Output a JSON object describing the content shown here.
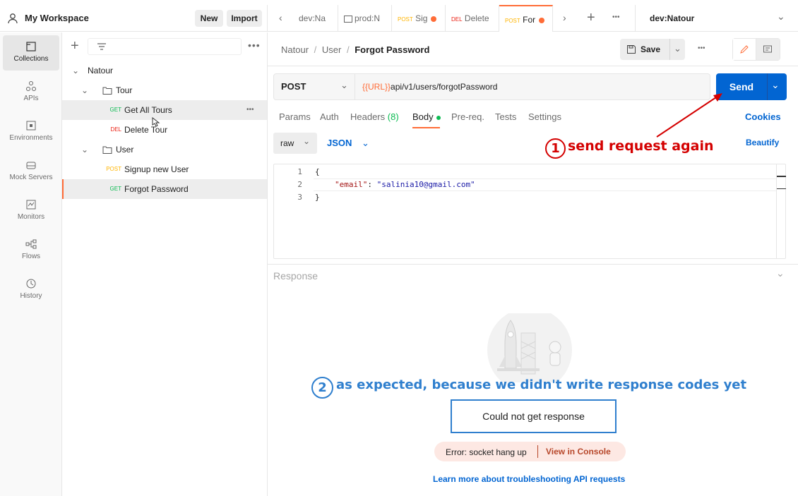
{
  "workspace": {
    "title": "My Workspace",
    "new_label": "New",
    "import_label": "Import"
  },
  "rail": [
    {
      "label": "Collections",
      "icon": "collections-icon"
    },
    {
      "label": "APIs",
      "icon": "apis-icon"
    },
    {
      "label": "Environments",
      "icon": "environments-icon"
    },
    {
      "label": "Mock Servers",
      "icon": "mock-servers-icon"
    },
    {
      "label": "Monitors",
      "icon": "monitors-icon"
    },
    {
      "label": "Flows",
      "icon": "flows-icon"
    },
    {
      "label": "History",
      "icon": "history-icon"
    }
  ],
  "tree": {
    "collection": "Natour",
    "folder_tour": "Tour",
    "folder_user": "User",
    "requests": [
      {
        "method": "GET",
        "name": "Get All Tours"
      },
      {
        "method": "DEL",
        "name": "Delete Tour"
      },
      {
        "method": "POST",
        "name": "Signup new User"
      },
      {
        "method": "GET",
        "name": "Forgot Password"
      }
    ]
  },
  "tabs": [
    {
      "method": "",
      "label": "dev:Na"
    },
    {
      "method": "",
      "label": "prod:N"
    },
    {
      "method": "POST",
      "label": "Sig"
    },
    {
      "method": "DEL",
      "label": "Delete"
    },
    {
      "method": "POST",
      "label": "For"
    }
  ],
  "environment": "dev:Natour",
  "breadcrumb": {
    "root": "Natour",
    "folder": "User",
    "current": "Forgot Password",
    "sep": "/"
  },
  "save_label": "Save",
  "request": {
    "method": "POST",
    "url_var": "{{URL}}",
    "url_path": "api/v1/users/forgotPassword",
    "send_label": "Send"
  },
  "req_tabs": {
    "params": "Params",
    "auth": "Auth",
    "headers": "Headers",
    "headers_count": "(8)",
    "body": "Body",
    "prereq": "Pre-req.",
    "tests": "Tests",
    "settings": "Settings",
    "cookies": "Cookies"
  },
  "body_options": {
    "mode": "raw",
    "format": "JSON",
    "beautify": "Beautify"
  },
  "editor": {
    "line_numbers": [
      "1",
      "2",
      "3"
    ],
    "line1": "{",
    "line2_key": "\"email\"",
    "line2_colon": ":",
    "line2_value": "\"salinia10@gmail.com\"",
    "line3": "}"
  },
  "response": {
    "title": "Response",
    "error_box": "Could not get response",
    "error_text": "Error: socket hang up",
    "view_console": "View in Console",
    "learn_more": "Learn more about troubleshooting API requests"
  },
  "annotations": {
    "one_num": "1",
    "one_text": "send request again",
    "two_num": "2",
    "two_text": "as expected, because we didn't write response codes yet"
  },
  "colors": {
    "accent": "#ff6c37",
    "send": "#0265d2",
    "annot_red": "#d40000",
    "annot_blue": "#2f7fce"
  }
}
